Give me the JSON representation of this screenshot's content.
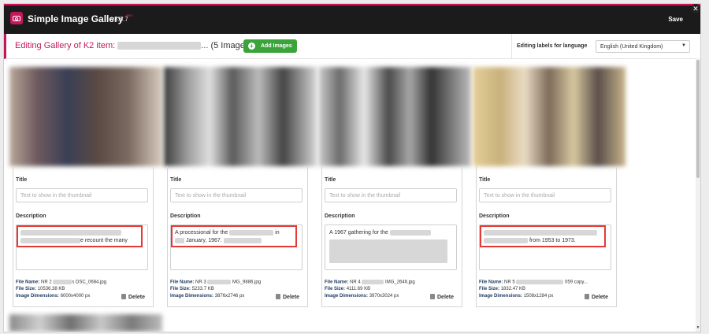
{
  "app": {
    "title": "Simple Image Gallery",
    "pro_badge": "PRO",
    "version": "v3.6.7",
    "save_label": "Save"
  },
  "gallery_header": {
    "title_prefix": "Editing Gallery of K2 item:",
    "ellipsis": "...",
    "image_count": "(5 Images)",
    "add_images_label": "Add Images",
    "lang_label": "Editing labels for language",
    "lang_value": "English (United Kingdom)"
  },
  "field_labels": {
    "title": "Title",
    "description": "Description",
    "title_placeholder": "Text to show in the thumbnail",
    "file_name": "File Name:",
    "file_size": "File Size:",
    "dimensions": "Image Dimensions:",
    "delete": "Delete"
  },
  "images": [
    {
      "file_name_start": "NR 2",
      "file_name_end": "s DSC_0684.jpg",
      "file_size": "10536.38 KB",
      "dimensions": "6000x4000 px",
      "desc_line1": "",
      "desc_line2": "e recount the many",
      "highlighted": true
    },
    {
      "file_name_start": "NR 3",
      "file_name_end": "MG_9886.jpg",
      "file_size": "5233.7 KB",
      "dimensions": "3876x2746 px",
      "desc_line1": "A processional for the",
      "desc_line1_end": "in",
      "desc_line2": "January, 1967.",
      "highlighted": true
    },
    {
      "file_name_start": "NR 4",
      "file_name_end": "IMG_2646.jpg",
      "file_size": "4111.69 KB",
      "dimensions": "3970x3024 px",
      "desc_line1": "A 1967 gathering for the",
      "desc_line2": "",
      "highlighted": false
    },
    {
      "file_name_start": "NR 5",
      "file_name_end": "059 copy...",
      "file_size": "1832.47 KB",
      "dimensions": "1508x1284 px",
      "desc_line1": "",
      "desc_line2": "from 1953 to 1973.",
      "highlighted": true
    }
  ],
  "colors": {
    "accent": "#c2185b",
    "topbar": "#1b1b1b",
    "add_button": "#3aa33a",
    "highlight_box": "#e53935",
    "meta_label": "#1e3a5f"
  }
}
